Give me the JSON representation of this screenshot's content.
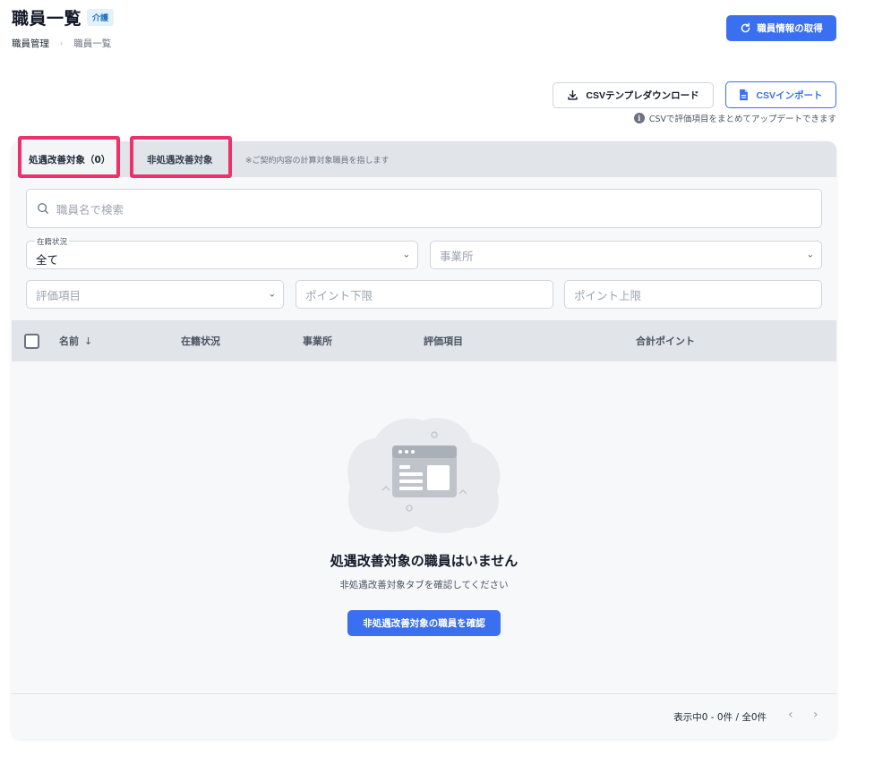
{
  "header": {
    "title": "職員一覧",
    "badge": "介護",
    "breadcrumb": [
      "職員管理",
      "職員一覧"
    ],
    "breadcrumb_sep": "›",
    "fetch_button": "職員情報の取得"
  },
  "csv": {
    "download_label": "CSVテンプレダウンロード",
    "import_label": "CSVインポート",
    "note": "CSVで評価項目をまとめてアップデートできます"
  },
  "tabs": {
    "active_label": "処遇改善対象（0）",
    "inactive_label": "非処遇改善対象",
    "note": "※ご契約内容の計算対象職員を指します"
  },
  "filters": {
    "search_placeholder": "職員名で検索",
    "status_label": "在籍状況",
    "status_value": "全て",
    "office_placeholder": "事業所",
    "item_placeholder": "評価項目",
    "point_min_placeholder": "ポイント下限",
    "point_max_placeholder": "ポイント上限"
  },
  "table": {
    "columns": [
      "名前",
      "在籍状況",
      "事業所",
      "評価項目",
      "合計ポイント"
    ],
    "sort_arrow": "↓"
  },
  "empty": {
    "title": "処遇改善対象の職員はいません",
    "subtitle": "非処遇改善対象タブを確認してください",
    "button": "非処遇改善対象の職員を確認"
  },
  "pagination": {
    "summary": "表示中0 - 0件 / 全0件"
  },
  "colors": {
    "primary": "#3a6ff0",
    "highlight": "#f0306a"
  }
}
